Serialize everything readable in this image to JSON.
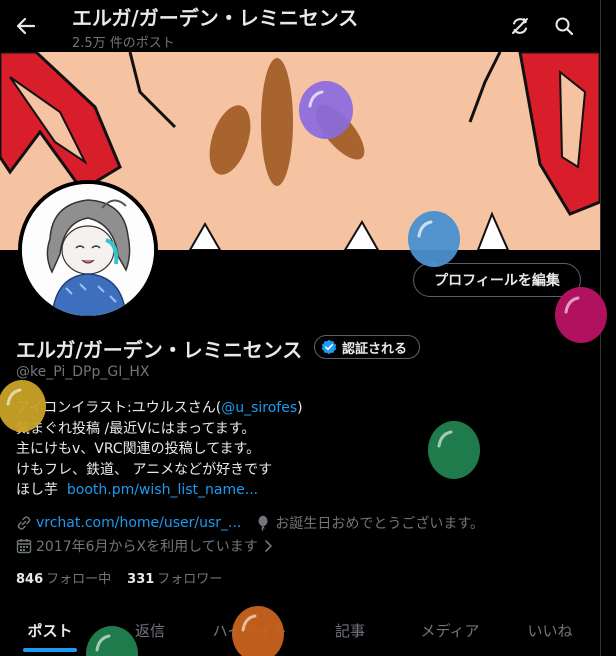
{
  "header": {
    "title": "エルガ/ガーデン・レミニセンス",
    "subtitle": "2.5万 件のポスト"
  },
  "profile": {
    "edit_button": "プロフィールを編集",
    "name": "エルガ/ガーデン・レミニセンス",
    "verify_label": "認証される",
    "handle": "@ke_Pi_DPp_GI_HX"
  },
  "bio": {
    "line1_text": "アイコンイラスト:ユウルスさん(",
    "line1_link": "@u_sirofes",
    "line1_end": ")",
    "line2": "気まぐれ投稿 /最近Vにはまってます。",
    "line3": "主にけもv、VRC関連の投稿してます。",
    "line4": "けもフレ、鉄道、 アニメなどが好きです",
    "line5_text": "ほし芋",
    "line5_link": "booth.pm/wish_list_name..."
  },
  "meta": {
    "website": "vrchat.com/home/user/usr_...",
    "birthday": "お誕生日おめでとうございます。",
    "joined": "2017年6月からXを利用しています"
  },
  "stats": {
    "following_count": "846",
    "following_label": "フォロー中",
    "followers_count": "331",
    "followers_label": "フォロワー"
  },
  "tabs": [
    {
      "label": "ポスト"
    },
    {
      "label": "返信"
    },
    {
      "label": "ハイライト"
    },
    {
      "label": "記事"
    },
    {
      "label": "メディア"
    },
    {
      "label": "いいね"
    }
  ],
  "colors": {
    "accent": "#1d9bf0",
    "banner": "#f6c3a2",
    "balloon_purple": "#8a6be0",
    "balloon_blue": "#4a90d0",
    "balloon_magenta": "#b0125f",
    "balloon_yellow": "#c9a227",
    "balloon_green": "#1f7a4c",
    "balloon_orange": "#c9621e"
  },
  "icons": {
    "back": "arrow-left-icon",
    "refresh": "refresh-off-icon",
    "search": "search-icon",
    "verified": "verified-badge-icon",
    "link": "link-icon",
    "birthday": "balloon-icon",
    "calendar": "calendar-icon"
  }
}
